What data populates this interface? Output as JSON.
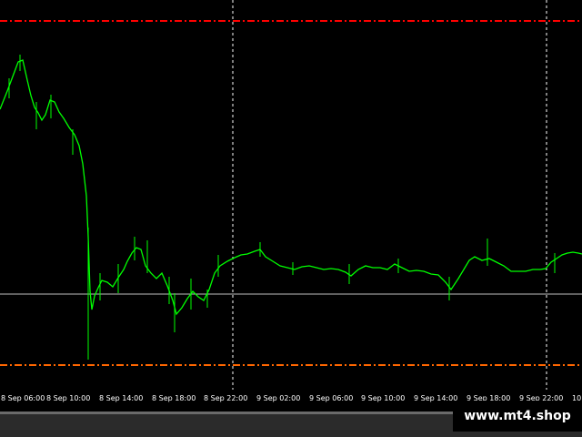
{
  "chart": {
    "background": "#000000",
    "bull_color": "#00ff00",
    "grid_color": "#ffffff",
    "upper_level_color": "#ff0000",
    "lower_level_color": "#ff6600",
    "current_price_line_color": "#c0c0c0"
  },
  "time_axis": {
    "labels": [
      "8 Sep 06:00",
      "8 Sep 10:00",
      "8 Sep 14:00",
      "8 Sep 18:00",
      "8 Sep 22:00",
      "9 Sep 02:00",
      "9 Sep 06:00",
      "9 Sep 10:00",
      "9 Sep 14:00",
      "9 Sep 18:00",
      "9 Sep 22:00",
      "10"
    ]
  },
  "watermark": {
    "text": "www.mt4.shop"
  }
}
